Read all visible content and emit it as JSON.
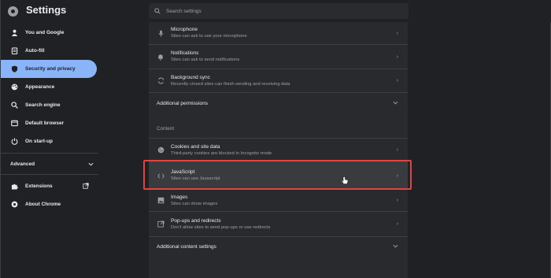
{
  "header": {
    "title": "Settings",
    "search_placeholder": "Search settings"
  },
  "sidebar": {
    "items": [
      {
        "label": "You and Google",
        "icon": "person-icon"
      },
      {
        "label": "Auto-fill",
        "icon": "clipboard-icon"
      },
      {
        "label": "Security and privacy",
        "icon": "shield-icon",
        "active": true
      },
      {
        "label": "Appearance",
        "icon": "palette-icon"
      },
      {
        "label": "Search engine",
        "icon": "search-icon"
      },
      {
        "label": "Default browser",
        "icon": "browser-icon"
      },
      {
        "label": "On start-up",
        "icon": "power-icon"
      }
    ],
    "advanced": "Advanced",
    "extensions": "Extensions",
    "about": "About Chrome"
  },
  "main": {
    "rows_top": [
      {
        "title": "Microphone",
        "subtitle": "Sites can ask to use your microphone",
        "icon": "microphone-icon"
      },
      {
        "title": "Notifications",
        "subtitle": "Sites can ask to send notifications",
        "icon": "bell-icon"
      },
      {
        "title": "Background sync",
        "subtitle": "Recently closed sites can finish sending and receiving data",
        "icon": "sync-icon"
      }
    ],
    "additional_permissions": "Additional permissions",
    "content_label": "Content",
    "rows_content": [
      {
        "title": "Cookies and site data",
        "subtitle": "Third-party cookies are blocked in Incognito mode",
        "icon": "cookie-icon"
      },
      {
        "title": "JavaScript",
        "subtitle": "Sites can use Javascript",
        "icon": "code-icon"
      },
      {
        "title": "Images",
        "subtitle": "Sites can show images",
        "icon": "image-icon"
      },
      {
        "title": "Pop-ups and redirects",
        "subtitle": "Don't allow sites to send pop-ups or use redirects",
        "icon": "popup-icon"
      }
    ],
    "additional_content": "Additional content settings"
  },
  "colors": {
    "accent": "#8ab4f8",
    "highlight": "#e0443e"
  }
}
